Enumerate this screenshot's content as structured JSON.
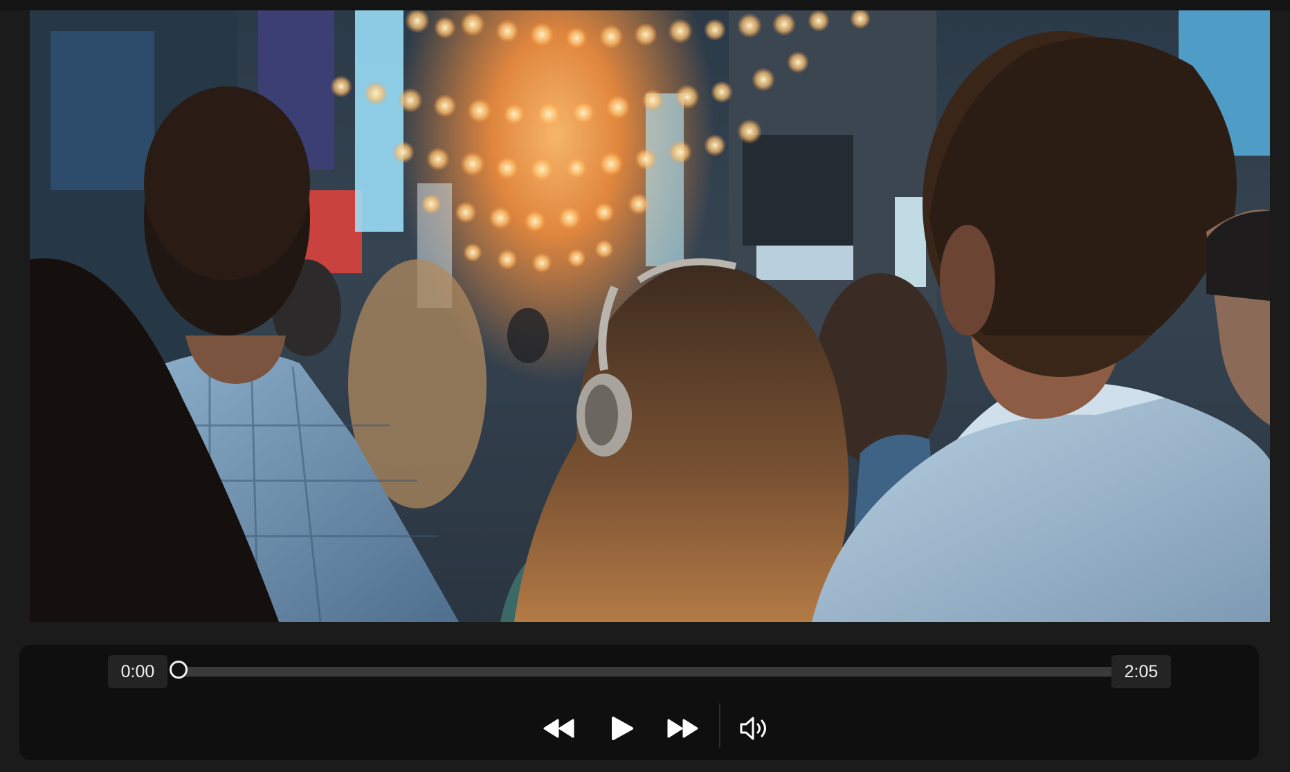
{
  "player": {
    "current_time": "0:00",
    "total_time": "2:05",
    "progress": 0,
    "icons": {
      "rewind": "rewind-icon",
      "play": "play-icon",
      "forward": "fast-forward-icon",
      "volume": "volume-icon"
    },
    "colors": {
      "background": "#1b1b1b",
      "controls_background": "#0f0f0f",
      "track": "#3a3a3a",
      "thumb": "#f4f4f4",
      "icon": "#ffffff"
    }
  }
}
